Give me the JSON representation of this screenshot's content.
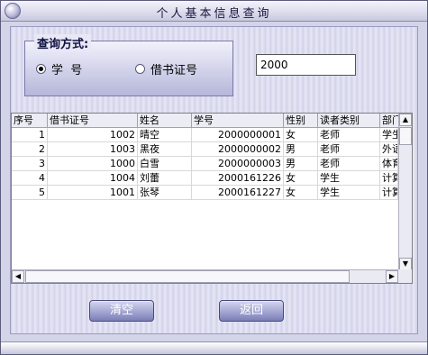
{
  "window": {
    "title": "个人基本信息查询"
  },
  "query": {
    "legend": "查询方式:",
    "options": [
      {
        "label": "学  号",
        "selected": true
      },
      {
        "label": "借书证号",
        "selected": false
      }
    ],
    "input_value": "2000"
  },
  "table": {
    "columns": [
      "序号",
      "借书证号",
      "姓名",
      "学号",
      "性别",
      "读者类别",
      "部门"
    ],
    "rows": [
      [
        "1",
        "1002",
        "晴空",
        "2000000001",
        "女",
        "老师",
        "学生"
      ],
      [
        "2",
        "1003",
        "黑夜",
        "2000000002",
        "男",
        "老师",
        "外语"
      ],
      [
        "3",
        "1000",
        "白雪",
        "2000000003",
        "男",
        "老师",
        "体育"
      ],
      [
        "4",
        "1004",
        "刘蕾",
        "2000161226",
        "女",
        "学生",
        "计算"
      ],
      [
        "5",
        "1001",
        "张琴",
        "2000161227",
        "女",
        "学生",
        "计算"
      ]
    ]
  },
  "buttons": {
    "clear_label": "清空",
    "back_label": "返回"
  },
  "colors": {
    "button_gradient_top": "#d4d6f0",
    "button_gradient_bottom": "#7b7eb6",
    "window_bg": "#d4d4e8"
  }
}
